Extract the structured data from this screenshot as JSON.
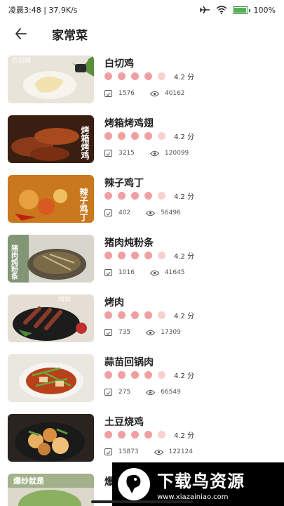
{
  "status_bar": {
    "time_speed": "凌晨3:48 | 37.9K/s",
    "battery_pct": "100%",
    "icons": [
      "airplane-icon",
      "wifi-icon",
      "battery-icon"
    ]
  },
  "header": {
    "back_icon": "arrow-left-icon",
    "title": "家常菜"
  },
  "recipes": [
    {
      "title": "白切鸡",
      "score": "4.2 分",
      "favorites": "1576",
      "views": "40162"
    },
    {
      "title": "烤箱烤鸡翅",
      "score": "4.2 分",
      "favorites": "3215",
      "views": "120099"
    },
    {
      "title": "辣子鸡丁",
      "score": "4.2 分",
      "favorites": "402",
      "views": "56496"
    },
    {
      "title": "猪肉炖粉条",
      "score": "4.2 分",
      "favorites": "1016",
      "views": "41645"
    },
    {
      "title": "烤肉",
      "score": "4.2 分",
      "favorites": "735",
      "views": "17309"
    },
    {
      "title": "蒜苗回锅肉",
      "score": "4.2 分",
      "favorites": "275",
      "views": "66549"
    },
    {
      "title": "土豆烧鸡",
      "score": "4.2 分",
      "favorites": "15873",
      "views": "122124"
    },
    {
      "title": "爆"
    }
  ],
  "thumb_captions": [
    "白切鸡",
    "烤箱烤鸡",
    "辣子鸡丁",
    "猪肉炖粉条",
    "烤肉",
    "爆炒就是"
  ],
  "rating_level": 4.2,
  "rating_max": 5,
  "colors": {
    "accent_dot": "#f0a0a0",
    "dot_light": "#f8d0d0"
  },
  "watermark": {
    "cn": "下载鸟资源",
    "url": "www.xiazainiao.com"
  }
}
